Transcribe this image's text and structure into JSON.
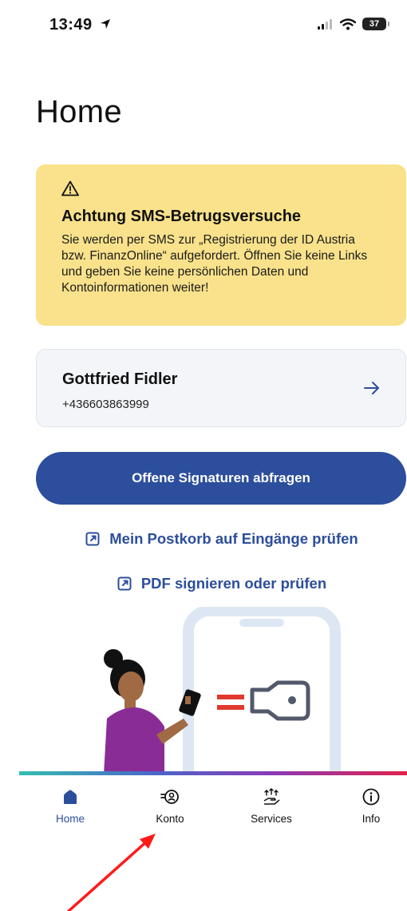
{
  "status_bar": {
    "time": "13:49",
    "battery": "37",
    "icons": [
      "location-arrow-icon",
      "signal-icon",
      "wifi-icon",
      "battery-icon"
    ]
  },
  "page": {
    "title": "Home"
  },
  "alert": {
    "icon": "warning-icon",
    "title": "Achtung SMS-Betrugsversuche",
    "body": "Sie werden per SMS zur „Registrierung der ID Austria bzw. FinanzOnline“ aufgefordert. Öffnen Sie keine Links und geben Sie keine persönlichen Daten und Kontoinformationen weiter!",
    "background": "#f9e28b"
  },
  "user": {
    "name": "Gottfried Fidler",
    "phone": "+436603863999",
    "icon": "arrow-right-icon"
  },
  "actions": {
    "primary_label": "Offene Signaturen abfragen",
    "link_postkorb": "Mein Postkorb auf Eingänge prüfen",
    "link_pdf": "PDF signieren oder prüfen",
    "link_icon": "external-link-icon"
  },
  "nav": {
    "items": [
      {
        "label": "Home",
        "icon": "home-icon",
        "active": true
      },
      {
        "label": "Konto",
        "icon": "account-icon",
        "active": false
      },
      {
        "label": "Services",
        "icon": "services-icon",
        "active": false
      },
      {
        "label": "Info",
        "icon": "info-icon",
        "active": false
      }
    ]
  },
  "colors": {
    "accent": "#2c4e9c",
    "alert": "#f9e28b",
    "annotation": "#ff1a1a"
  }
}
